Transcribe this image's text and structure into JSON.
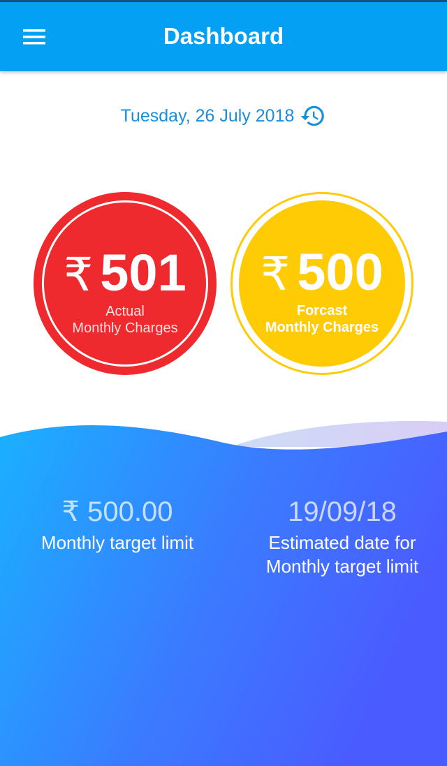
{
  "header": {
    "title": "Dashboard",
    "menu_icon": "hamburger-menu-icon",
    "color": "#03a0f4"
  },
  "date": {
    "text": "Tuesday, 26 July 2018",
    "icon": "history-icon",
    "color": "#1a8fd9"
  },
  "cards": {
    "actual": {
      "currency": "₹",
      "amount": "501",
      "label_line1": "Actual",
      "label_line2": "Monthly Charges",
      "color": "#ee2a2e"
    },
    "forecast": {
      "currency": "₹",
      "amount": "500",
      "label_line1": "Forcast",
      "label_line2": "Monthly Charges",
      "color": "#ffcb05"
    }
  },
  "stats": {
    "target_value": "₹ 500.00",
    "target_label": "Monthly target limit",
    "estimated_value": "19/09/18",
    "estimated_label_line1": "Estimated date for",
    "estimated_label_line2": "Monthly target limit"
  },
  "gradient": {
    "start": "#1ab0ff",
    "end": "#4a5cff"
  }
}
